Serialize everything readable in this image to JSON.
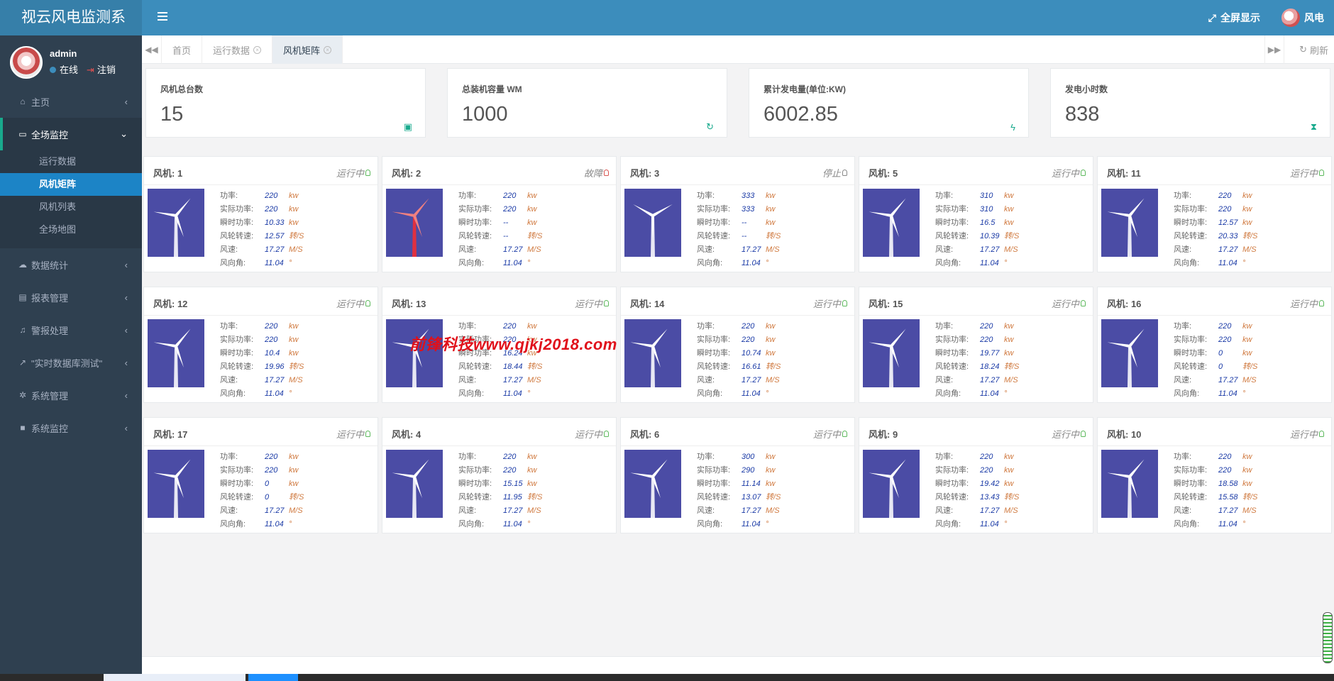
{
  "app": {
    "title": "视云风电监测系"
  },
  "topbar": {
    "fullscreen_label": "全屏显示",
    "user_label": "风电"
  },
  "user": {
    "name": "admin",
    "status": "在线",
    "logout": "注销"
  },
  "sidebar": {
    "items": [
      {
        "label": "主页",
        "icon": "home-icon"
      },
      {
        "label": "全场监控",
        "icon": "monitor-icon",
        "open": true,
        "children": [
          "运行数据",
          "风机矩阵",
          "风机列表",
          "全场地图"
        ],
        "active_child": "风机矩阵"
      },
      {
        "label": "数据统计",
        "icon": "cloud-icon"
      },
      {
        "label": "报表管理",
        "icon": "report-icon"
      },
      {
        "label": "警报处理",
        "icon": "bell-icon"
      },
      {
        "label": "\"实时数据库测试\"",
        "icon": "chart-icon"
      },
      {
        "label": "系统管理",
        "icon": "gear-icon"
      },
      {
        "label": "系统监控",
        "icon": "camera-icon"
      }
    ]
  },
  "tabs": [
    {
      "label": "首页",
      "closable": false,
      "active": false
    },
    {
      "label": "运行数据",
      "closable": true,
      "active": false
    },
    {
      "label": "风机矩阵",
      "closable": true,
      "active": true
    }
  ],
  "refresh_label": "刷新",
  "stats": [
    {
      "label": "风机总台数",
      "value": "15",
      "icon": "image-icon"
    },
    {
      "label": "总装机容量 WM",
      "value": "1000",
      "icon": "refresh-icon"
    },
    {
      "label": "累计发电量(单位:KW)",
      "value": "6002.85",
      "icon": "bolt-icon"
    },
    {
      "label": "发电小时数",
      "value": "838",
      "icon": "hourglass-icon"
    }
  ],
  "param_labels": [
    "功率:",
    "实际功率:",
    "瞬时功率:",
    "风轮转速:",
    "风速:",
    "风向角:"
  ],
  "param_units": [
    "kw",
    "kw",
    "kw",
    "转/S",
    "M/S",
    "°"
  ],
  "turbines": [
    {
      "title": "风机: 1",
      "status": "运行中",
      "state": "run",
      "values": [
        "220",
        "220",
        "10.33",
        "12.57",
        "17.27",
        "11.04"
      ]
    },
    {
      "title": "风机: 2",
      "status": "故障",
      "state": "fault",
      "values": [
        "220",
        "220",
        "--",
        "--",
        "17.27",
        "11.04"
      ]
    },
    {
      "title": "风机: 3",
      "status": "停止",
      "state": "stop",
      "values": [
        "333",
        "333",
        "--",
        "--",
        "17.27",
        "11.04"
      ]
    },
    {
      "title": "风机: 5",
      "status": "运行中",
      "state": "run",
      "values": [
        "310",
        "310",
        "16.5",
        "10.39",
        "17.27",
        "11.04"
      ]
    },
    {
      "title": "风机: 11",
      "status": "运行中",
      "state": "run",
      "values": [
        "220",
        "220",
        "12.57",
        "20.33",
        "17.27",
        "11.04"
      ]
    },
    {
      "title": "风机: 12",
      "status": "运行中",
      "state": "run",
      "values": [
        "220",
        "220",
        "10.4",
        "19.96",
        "17.27",
        "11.04"
      ]
    },
    {
      "title": "风机: 13",
      "status": "运行中",
      "state": "run",
      "values": [
        "220",
        "220",
        "16.24",
        "18.44",
        "17.27",
        "11.04"
      ]
    },
    {
      "title": "风机: 14",
      "status": "运行中",
      "state": "run",
      "values": [
        "220",
        "220",
        "10.74",
        "16.61",
        "17.27",
        "11.04"
      ]
    },
    {
      "title": "风机: 15",
      "status": "运行中",
      "state": "run",
      "values": [
        "220",
        "220",
        "19.77",
        "18.24",
        "17.27",
        "11.04"
      ]
    },
    {
      "title": "风机: 16",
      "status": "运行中",
      "state": "run",
      "values": [
        "220",
        "220",
        "0",
        "0",
        "17.27",
        "11.04"
      ]
    },
    {
      "title": "风机: 17",
      "status": "运行中",
      "state": "run",
      "values": [
        "220",
        "220",
        "0",
        "0",
        "17.27",
        "11.04"
      ]
    },
    {
      "title": "风机: 4",
      "status": "运行中",
      "state": "run",
      "values": [
        "220",
        "220",
        "15.15",
        "11.95",
        "17.27",
        "11.04"
      ]
    },
    {
      "title": "风机: 6",
      "status": "运行中",
      "state": "run",
      "values": [
        "300",
        "290",
        "11.14",
        "13.07",
        "17.27",
        "11.04"
      ]
    },
    {
      "title": "风机: 9",
      "status": "运行中",
      "state": "run",
      "values": [
        "220",
        "220",
        "19.42",
        "13.43",
        "17.27",
        "11.04"
      ]
    },
    {
      "title": "风机: 10",
      "status": "运行中",
      "state": "run",
      "values": [
        "220",
        "220",
        "18.58",
        "15.58",
        "17.27",
        "11.04"
      ]
    }
  ],
  "watermark": "前锋科技www.qjkj2018.com",
  "colors": {
    "header": "#3c8dbc",
    "sidebar": "#2f4050",
    "active_nav": "#1c84c6",
    "turbine_bg": "#4b4ca5",
    "value": "#1a3aa6",
    "unit": "#d07a40"
  }
}
